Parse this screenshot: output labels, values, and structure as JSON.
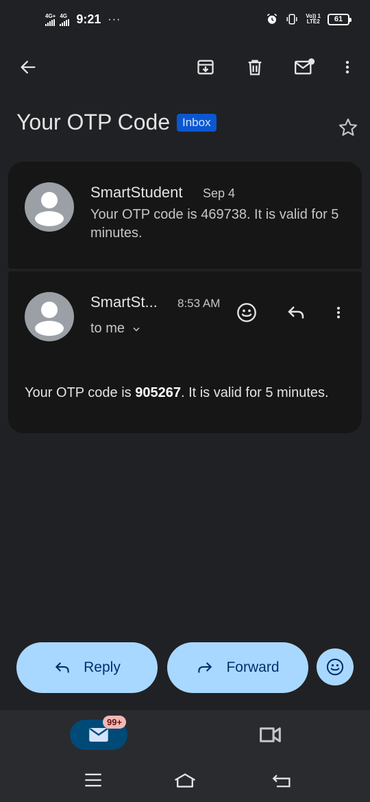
{
  "status_bar": {
    "net1": "4G+",
    "net2": "4G",
    "time": "9:21",
    "dots": "···",
    "volte": "Vo)) 1\nLTE2",
    "battery": "61"
  },
  "toolbar": {
    "back_icon": "arrow-back-icon",
    "archive_icon": "archive-icon",
    "delete_icon": "trash-icon",
    "unread_icon": "mark-unread-icon",
    "more_icon": "more-vert-icon"
  },
  "email": {
    "subject": "Your OTP Code",
    "label": "Inbox"
  },
  "messages": [
    {
      "sender": "SmartStudent",
      "date": "Sep 4",
      "snippet": "Your OTP code is 469738. It is valid for 5 minutes."
    },
    {
      "sender": "SmartSt...",
      "time": "8:53 AM",
      "recipient": "to me",
      "body_prefix": "Your OTP code is ",
      "body_code": "905267",
      "body_suffix": ". It is valid for 5 minutes."
    }
  ],
  "actions": {
    "reply": "Reply",
    "forward": "Forward"
  },
  "bottom_nav": {
    "mail_badge": "99+"
  },
  "colors": {
    "background": "#202124",
    "card": "#161616",
    "accent_button": "#a8d8ff",
    "label_badge": "#0b57d0"
  }
}
